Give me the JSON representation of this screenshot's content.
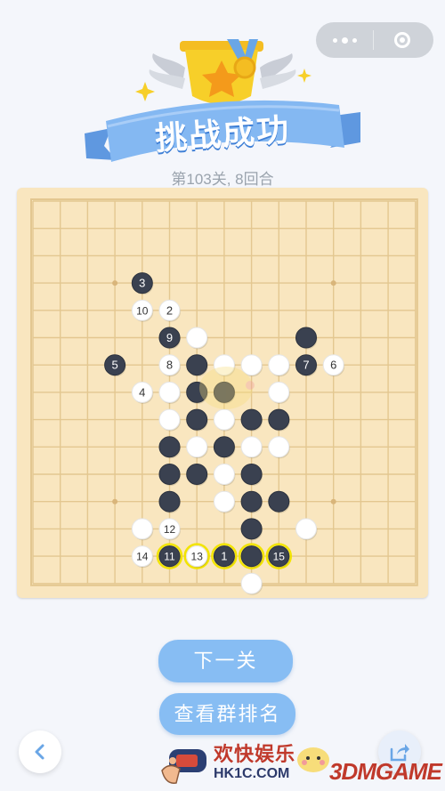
{
  "header": {
    "title": "挑战成功",
    "level_info": "第103关, 8回合"
  },
  "capsule": {
    "more_icon": "more-dots-icon",
    "close_icon": "target-close-icon"
  },
  "board": {
    "size": 15,
    "star_points": [
      [
        3,
        3
      ],
      [
        11,
        3
      ],
      [
        3,
        11
      ],
      [
        11,
        11
      ],
      [
        7,
        7
      ]
    ],
    "black_stones": [
      {
        "col": 4,
        "row": 3,
        "label": "3"
      },
      {
        "col": 5,
        "row": 5,
        "label": "9"
      },
      {
        "col": 3,
        "row": 6,
        "label": "5"
      },
      {
        "col": 10,
        "row": 5,
        "label": ""
      },
      {
        "col": 6,
        "row": 6,
        "label": ""
      },
      {
        "col": 10,
        "row": 6,
        "label": "7"
      },
      {
        "col": 6,
        "row": 7,
        "label": ""
      },
      {
        "col": 7,
        "row": 7,
        "label": ""
      },
      {
        "col": 6,
        "row": 8,
        "label": ""
      },
      {
        "col": 8,
        "row": 8,
        "label": ""
      },
      {
        "col": 9,
        "row": 8,
        "label": ""
      },
      {
        "col": 5,
        "row": 9,
        "label": ""
      },
      {
        "col": 7,
        "row": 9,
        "label": ""
      },
      {
        "col": 5,
        "row": 10,
        "label": ""
      },
      {
        "col": 6,
        "row": 10,
        "label": ""
      },
      {
        "col": 8,
        "row": 10,
        "label": ""
      },
      {
        "col": 5,
        "row": 11,
        "label": ""
      },
      {
        "col": 8,
        "row": 11,
        "label": ""
      },
      {
        "col": 9,
        "row": 11,
        "label": ""
      },
      {
        "col": 8,
        "row": 12,
        "label": ""
      },
      {
        "col": 5,
        "row": 13,
        "label": "11",
        "win": true
      },
      {
        "col": 7,
        "row": 13,
        "label": "1",
        "win": true
      },
      {
        "col": 8,
        "row": 13,
        "label": "",
        "win": true
      },
      {
        "col": 9,
        "row": 13,
        "label": "15",
        "win": true
      }
    ],
    "white_stones": [
      {
        "col": 4,
        "row": 4,
        "label": "10"
      },
      {
        "col": 5,
        "row": 4,
        "label": "2"
      },
      {
        "col": 6,
        "row": 5,
        "label": ""
      },
      {
        "col": 5,
        "row": 6,
        "label": "8"
      },
      {
        "col": 7,
        "row": 6,
        "label": ""
      },
      {
        "col": 8,
        "row": 6,
        "label": ""
      },
      {
        "col": 9,
        "row": 6,
        "label": ""
      },
      {
        "col": 11,
        "row": 6,
        "label": "6"
      },
      {
        "col": 4,
        "row": 7,
        "label": "4"
      },
      {
        "col": 5,
        "row": 7,
        "label": ""
      },
      {
        "col": 9,
        "row": 7,
        "label": ""
      },
      {
        "col": 5,
        "row": 8,
        "label": ""
      },
      {
        "col": 7,
        "row": 8,
        "label": ""
      },
      {
        "col": 6,
        "row": 9,
        "label": ""
      },
      {
        "col": 8,
        "row": 9,
        "label": ""
      },
      {
        "col": 9,
        "row": 9,
        "label": ""
      },
      {
        "col": 7,
        "row": 10,
        "label": ""
      },
      {
        "col": 7,
        "row": 11,
        "label": ""
      },
      {
        "col": 4,
        "row": 12,
        "label": ""
      },
      {
        "col": 5,
        "row": 12,
        "label": "12"
      },
      {
        "col": 10,
        "row": 12,
        "label": ""
      },
      {
        "col": 4,
        "row": 13,
        "label": "14"
      },
      {
        "col": 6,
        "row": 13,
        "label": "13",
        "win": true
      },
      {
        "col": 8,
        "row": 14,
        "label": ""
      }
    ],
    "colors": {
      "grid": "#e3c790",
      "board": "#f9e6bf",
      "black": "#3a4150",
      "white": "#ffffff",
      "win_ring": "#f2e400"
    }
  },
  "buttons": {
    "next_level": "下一关",
    "view_rank": "查看群排名"
  },
  "nav": {
    "back_icon": "chevron-left-icon",
    "share_icon": "share-icon"
  },
  "watermark": {
    "cn": "欢快娱乐",
    "url": "HK1C.COM",
    "brand": "3DMGAME"
  }
}
